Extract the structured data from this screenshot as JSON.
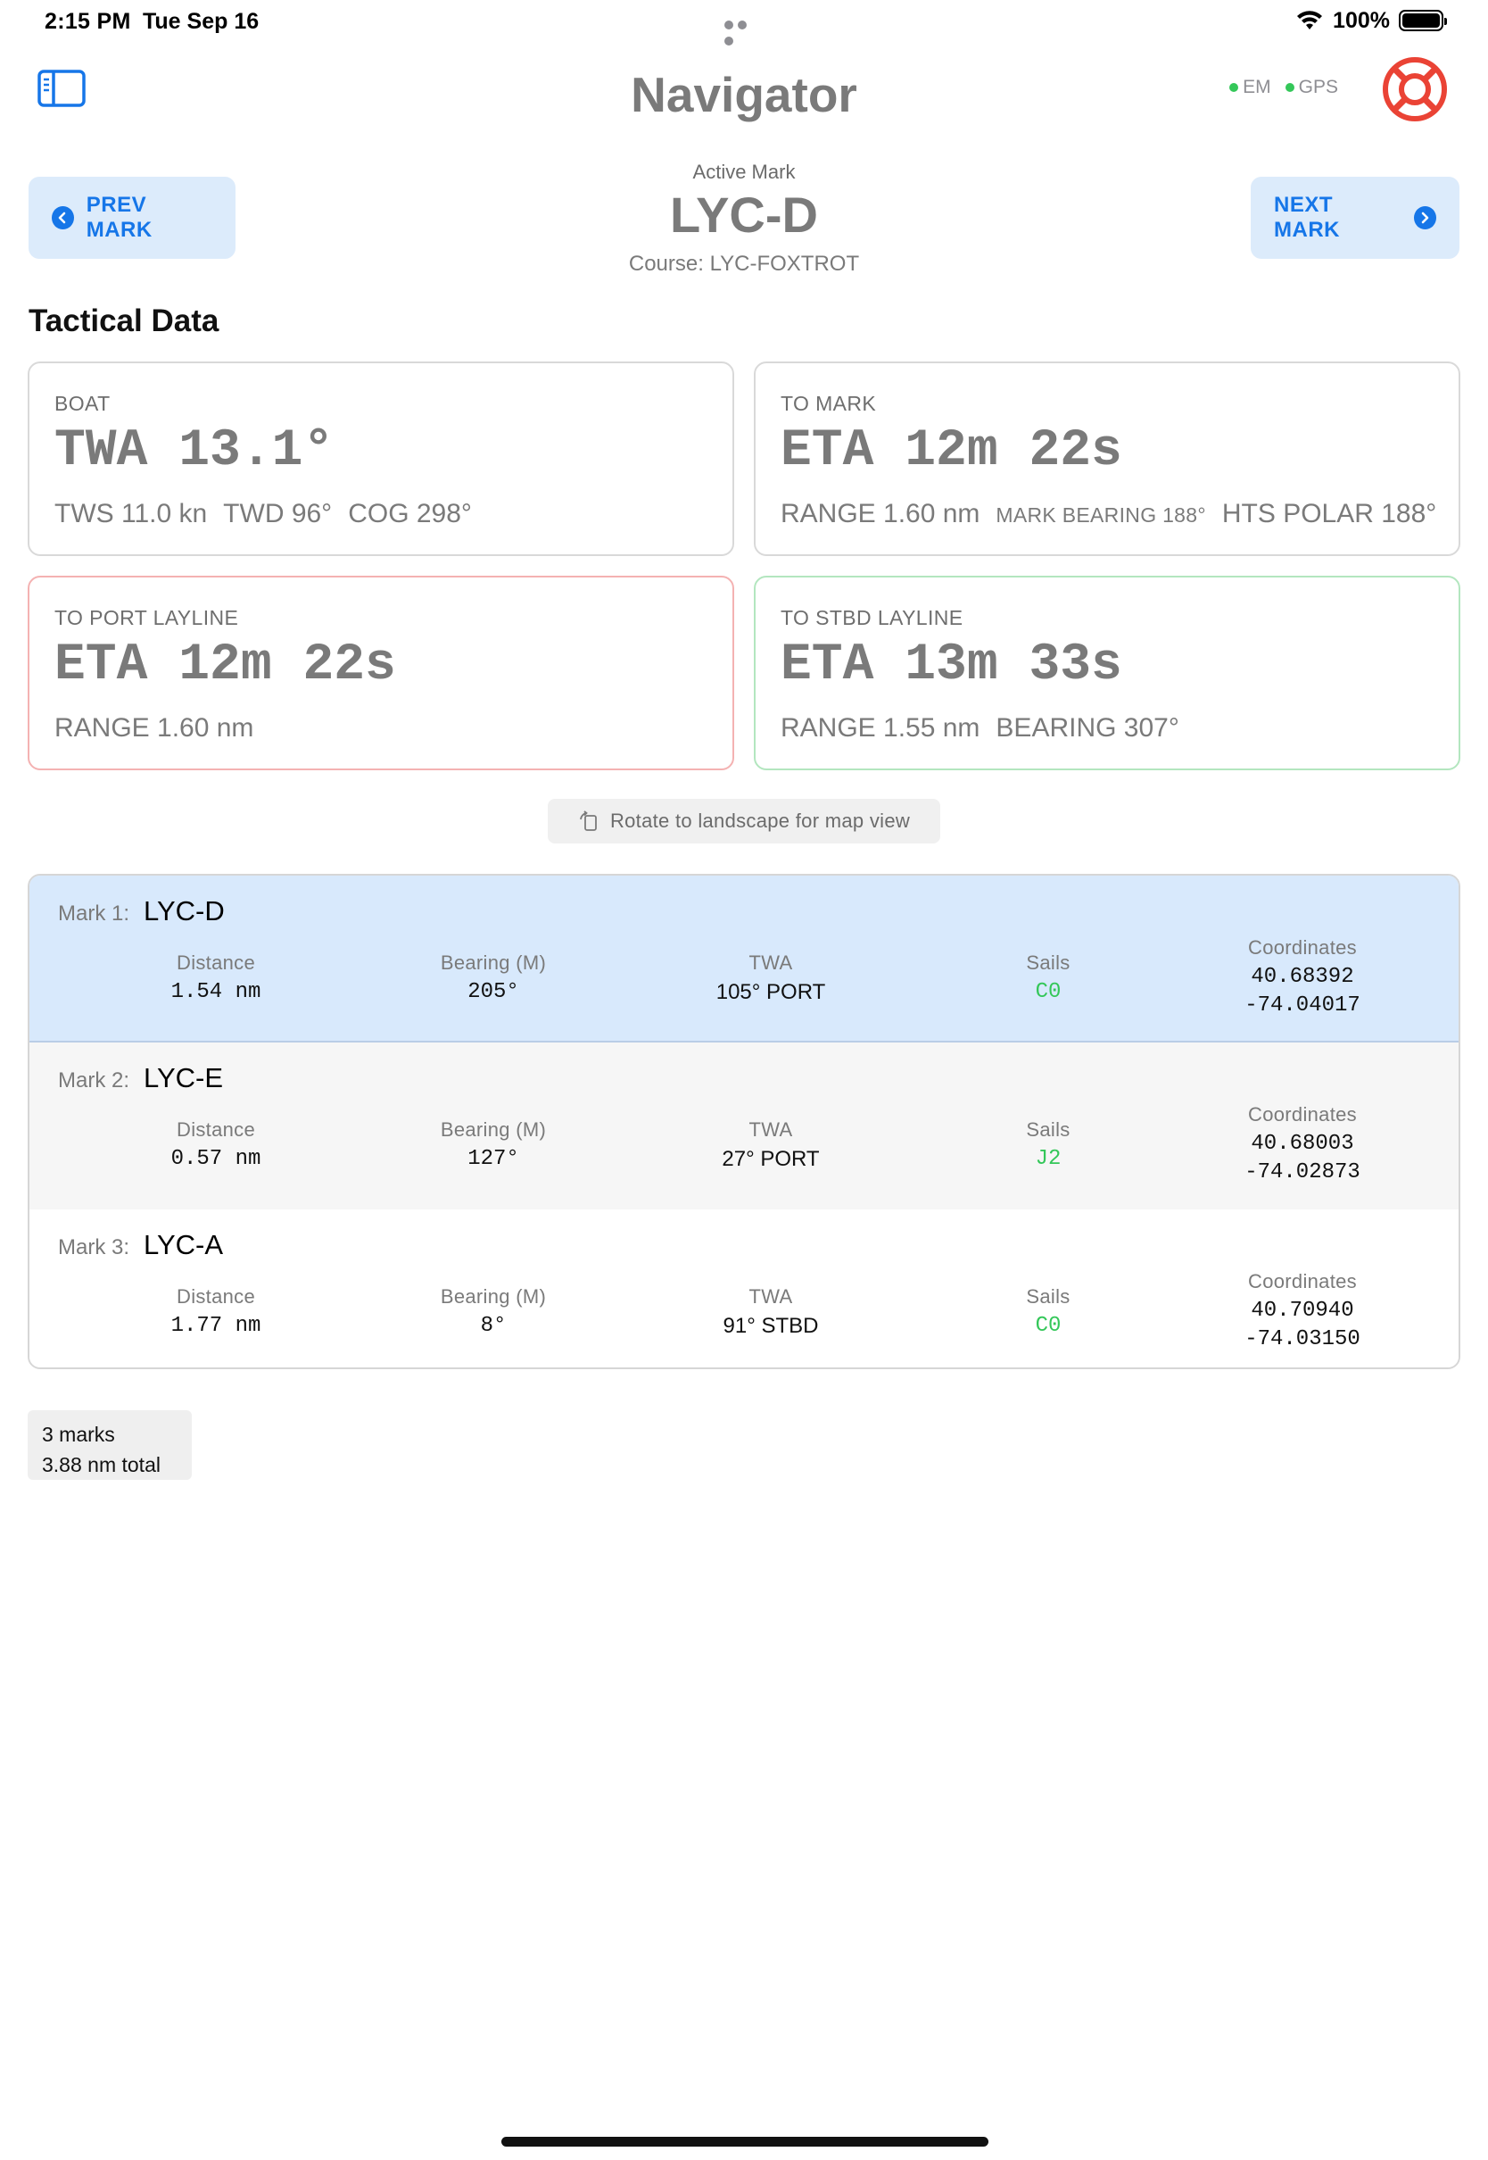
{
  "status_bar": {
    "time": "2:15 PM",
    "date": "Tue Sep 16",
    "battery": "100%"
  },
  "header": {
    "title": "Navigator",
    "indicators": [
      {
        "label": "EM",
        "color": "#34c759"
      },
      {
        "label": "GPS",
        "color": "#34c759"
      }
    ],
    "sidebar_icon": "sidebar-toggle-icon",
    "help_icon": "lifebuoy-icon"
  },
  "active_mark": {
    "label": "Active Mark",
    "name": "LYC-D",
    "course": "Course: LYC-FOXTROT"
  },
  "nav_buttons": {
    "prev": "PREV MARK",
    "next": "NEXT MARK"
  },
  "tactical": {
    "title": "Tactical Data",
    "boat": {
      "label": "BOAT",
      "main": "TWA 13.1°",
      "tws": "TWS 11.0 kn",
      "twd": "TWD 96°",
      "cog": "COG 298°"
    },
    "to_mark": {
      "label": "TO MARK",
      "main": "ETA 12m 22s",
      "range": "RANGE 1.60 nm",
      "mark_bearing": "MARK BEARING 188°",
      "hts_polar": "HTS POLAR 188°"
    },
    "port_layline": {
      "label": "TO PORT LAYLINE",
      "main": "ETA 12m 22s",
      "range": "RANGE 1.60 nm"
    },
    "stbd_layline": {
      "label": "TO STBD LAYLINE",
      "main": "ETA 13m 33s",
      "range": "RANGE 1.55 nm",
      "bearing": "BEARING 307°"
    }
  },
  "rotate_hint": "Rotate to landscape for map view",
  "columns": {
    "distance": "Distance",
    "bearing": "Bearing (M)",
    "twa": "TWA",
    "sails": "Sails",
    "coordinates": "Coordinates"
  },
  "marks": [
    {
      "index": "Mark 1:",
      "name": "LYC-D",
      "distance": "1.54 nm",
      "bearing": "205°",
      "twa": "105° PORT",
      "sails": "C0",
      "lat": "40.68392",
      "lon": "-74.04017",
      "active": true
    },
    {
      "index": "Mark 2:",
      "name": "LYC-E",
      "distance": "0.57 nm",
      "bearing": "127°",
      "twa": "27° PORT",
      "sails": "J2",
      "lat": "40.68003",
      "lon": "-74.02873",
      "active": false
    },
    {
      "index": "Mark 3:",
      "name": "LYC-A",
      "distance": "1.77 nm",
      "bearing": "8°",
      "twa": "91° STBD",
      "sails": "C0",
      "lat": "40.70940",
      "lon": "-74.03150",
      "active": false
    }
  ],
  "summary": {
    "count": "3 marks",
    "total": "3.88 nm total"
  },
  "colors": {
    "accent": "#1676e8",
    "active_row": "#d8e9fc",
    "sails_green": "#34c759",
    "port_border": "#f4b2b2",
    "stbd_border": "#b3e6bf"
  }
}
